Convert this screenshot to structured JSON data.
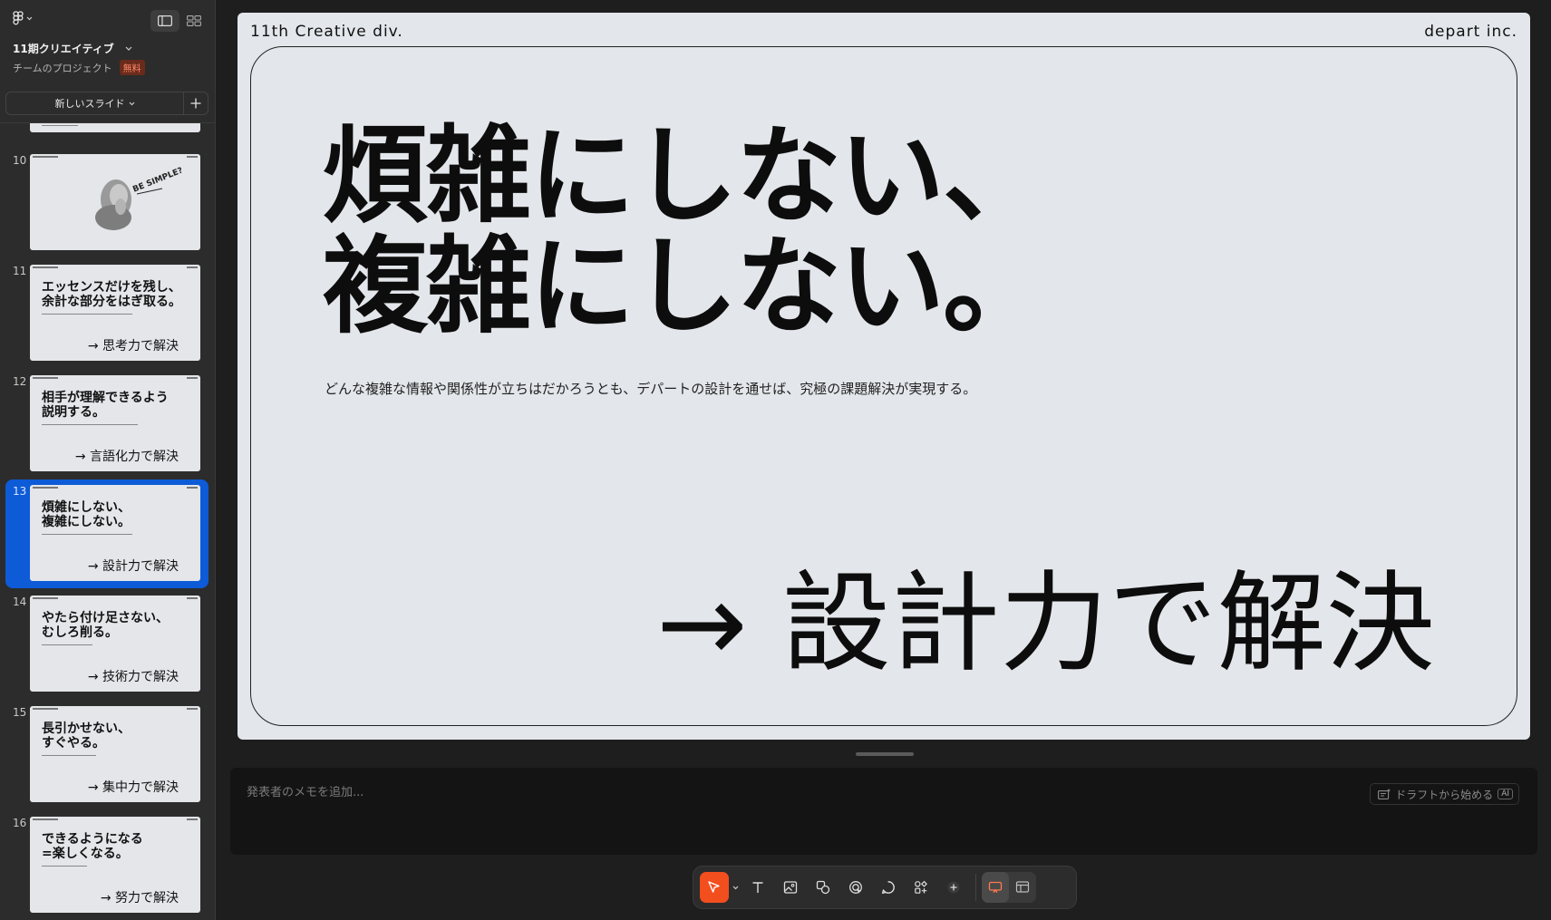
{
  "sidebar": {
    "project_title": "11期クリエイティブ",
    "project_sub": "チームのプロジェクト",
    "plan_badge": "無料",
    "new_slide_label": "新しいスライド",
    "slides": [
      {
        "num": "10",
        "title": "",
        "solution": "",
        "art": "BE SIMPLE?"
      },
      {
        "num": "11",
        "title": "エッセンスだけを残し、\n余計な部分をはぎ取る。",
        "solution": "→ 思考力で解決"
      },
      {
        "num": "12",
        "title": "相手が理解できるよう\n説明する。",
        "solution": "→ 言語化力で解決"
      },
      {
        "num": "13",
        "title": "煩雑にしない、\n複雑にしない。",
        "solution": "→ 設計力で解決"
      },
      {
        "num": "14",
        "title": "やたら付け足さない、\nむしろ削る。",
        "solution": "→ 技術力で解決"
      },
      {
        "num": "15",
        "title": "長引かせない、\nすぐやる。",
        "solution": "→ 集中力で解決"
      },
      {
        "num": "16",
        "title": "できるようになる\n=楽しくなる。",
        "solution": "→ 努力で解決"
      }
    ]
  },
  "slide": {
    "header_left": "11th Creative div.",
    "header_right": "depart inc.",
    "title_line1": "煩雑にしない、",
    "title_line2": "複雑にしない。",
    "description": "どんな複雑な情報や関係性が立ちはだかろうとも、デパートの設計を通せば、究極の課題解決が実現する。",
    "solution": "→ 設計力で解決"
  },
  "notes": {
    "placeholder": "発表者のメモを追加...",
    "draft_label": "ドラフトから始める",
    "ai_tag": "AI"
  },
  "colors": {
    "accent": "#f24e1e",
    "selection": "#0d5bd7",
    "slide_bg": "#e3e6ea"
  }
}
